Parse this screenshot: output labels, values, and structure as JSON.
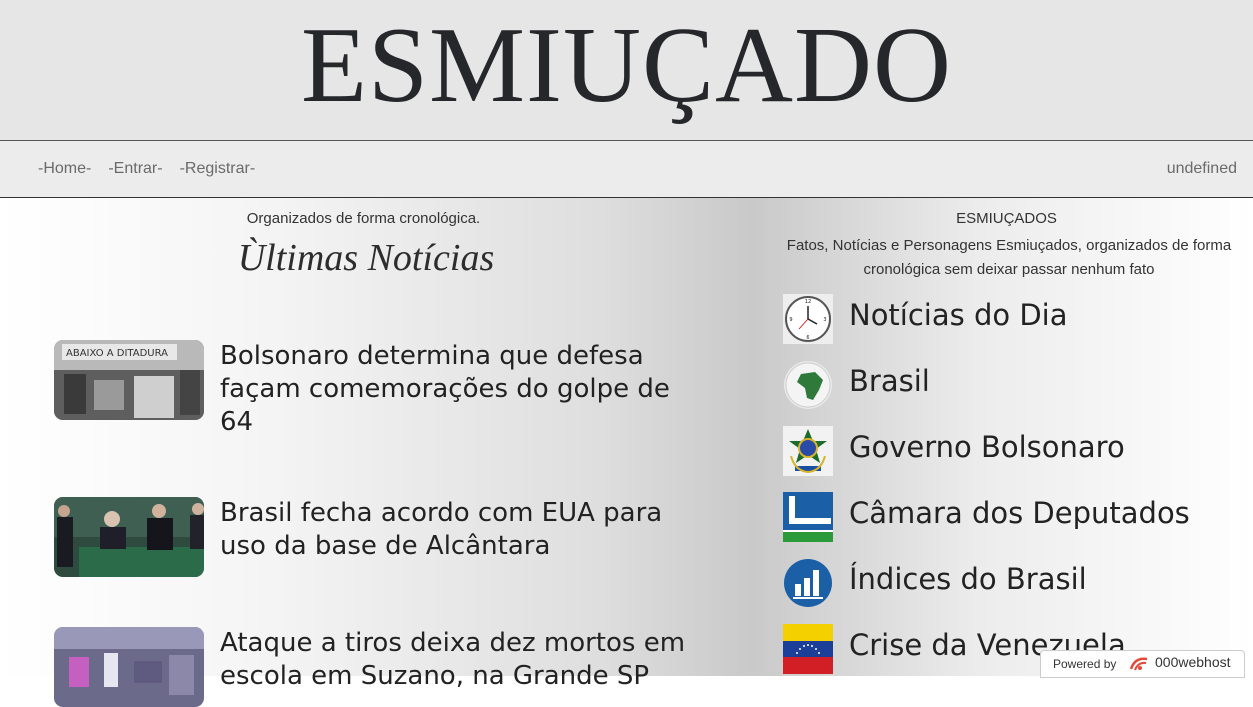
{
  "site": {
    "logo": "ESMIUÇADO"
  },
  "nav": {
    "items": [
      {
        "label": "-Home-"
      },
      {
        "label": "-Entrar-"
      },
      {
        "label": "-Registrar-"
      }
    ],
    "user": "undefined"
  },
  "left": {
    "subtitle": "Organizados de forma cronológica.",
    "title": "Ùltimas Notícias",
    "news": [
      {
        "title": "Bolsonaro determina que defesa façam comemorações do golpe de 64",
        "thumb_icon": "protest-photo"
      },
      {
        "title": "Brasil fecha acordo com EUA para uso da base de Alcântara",
        "thumb_icon": "signing-photo"
      },
      {
        "title": "Ataque a tiros deixa dez mortos em escola em Suzano, na Grande SP",
        "thumb_icon": "school-photo"
      }
    ]
  },
  "right": {
    "heading": "ESMIUÇADOS",
    "description": "Fatos, Notícias e Personagens Esmiuçados, organizados de forma cronológica sem deixar passar nenhum fato",
    "categories": [
      {
        "label": "Notícias do Dia",
        "icon": "clock-icon"
      },
      {
        "label": "Brasil",
        "icon": "globe-icon"
      },
      {
        "label": "Governo Bolsonaro",
        "icon": "coat-of-arms-icon"
      },
      {
        "label": "Câmara dos Deputados",
        "icon": "chamber-icon"
      },
      {
        "label": "Índices do Brasil",
        "icon": "bar-chart-icon"
      },
      {
        "label": "Crise da Venezuela",
        "icon": "venezuela-flag-icon"
      }
    ]
  },
  "badge": {
    "powered": "Powered by",
    "brand": "000webhost"
  },
  "colors": {
    "masthead_bg": "#e6e6e6",
    "text": "#222222",
    "nav_text": "#6a6a6a"
  }
}
